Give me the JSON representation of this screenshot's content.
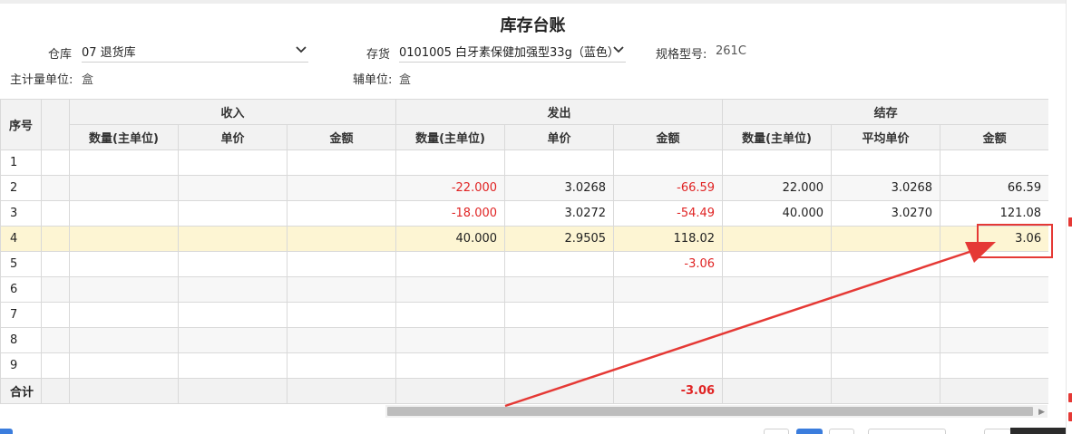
{
  "title": "库存台账",
  "form": {
    "warehouse_label": "仓库",
    "warehouse_value": "07 退货库",
    "stock_label": "存货",
    "stock_value": "0101005 白牙素保健加强型33g（蓝色）",
    "spec_label": "规格型号:",
    "spec_value": "261C",
    "main_unit_label": "主计量单位:",
    "main_unit_value": "盒",
    "aux_unit_label": "辅单位:",
    "aux_unit_value": "盒"
  },
  "table": {
    "seq_header": "序号",
    "groups": [
      "收入",
      "发出",
      "结存"
    ],
    "columns": [
      "数量(主单位)",
      "单价",
      "金额",
      "数量(主单位)",
      "单价",
      "金额",
      "数量(主单位)",
      "平均单价",
      "金额"
    ],
    "rows": [
      {
        "seq": "1",
        "cells": [
          "",
          "",
          "",
          "",
          "",
          "",
          "",
          "",
          ""
        ]
      },
      {
        "seq": "2",
        "cells": [
          "",
          "",
          "",
          "-22.000",
          "3.0268",
          "-66.59",
          "22.000",
          "3.0268",
          "66.59"
        ]
      },
      {
        "seq": "3",
        "cells": [
          "",
          "",
          "",
          "-18.000",
          "3.0272",
          "-54.49",
          "40.000",
          "3.0270",
          "121.08"
        ]
      },
      {
        "seq": "4",
        "cells": [
          "",
          "",
          "",
          "40.000",
          "2.9505",
          "118.02",
          "",
          "",
          "3.06"
        ]
      },
      {
        "seq": "5",
        "cells": [
          "",
          "",
          "",
          "",
          "",
          "-3.06",
          "",
          "",
          ""
        ]
      },
      {
        "seq": "6",
        "cells": [
          "",
          "",
          "",
          "",
          "",
          "",
          "",
          "",
          ""
        ]
      },
      {
        "seq": "7",
        "cells": [
          "",
          "",
          "",
          "",
          "",
          "",
          "",
          "",
          ""
        ]
      },
      {
        "seq": "8",
        "cells": [
          "",
          "",
          "",
          "",
          "",
          "",
          "",
          "",
          ""
        ]
      },
      {
        "seq": "9",
        "cells": [
          "",
          "",
          "",
          "",
          "",
          "",
          "",
          "",
          ""
        ]
      }
    ],
    "total_label": "合计",
    "totals": [
      "",
      "",
      "",
      "",
      "",
      "-3.06",
      "",
      "",
      ""
    ]
  },
  "selected_row": "4",
  "colors": {
    "negative": "#e02424",
    "selected_row": "#fdf5d3",
    "annotation": "#e53935",
    "header_bg": "#f2f2f2"
  },
  "icons": {
    "dropdown": "chevron-down-icon",
    "scroll_right": "triangle-right-icon"
  }
}
